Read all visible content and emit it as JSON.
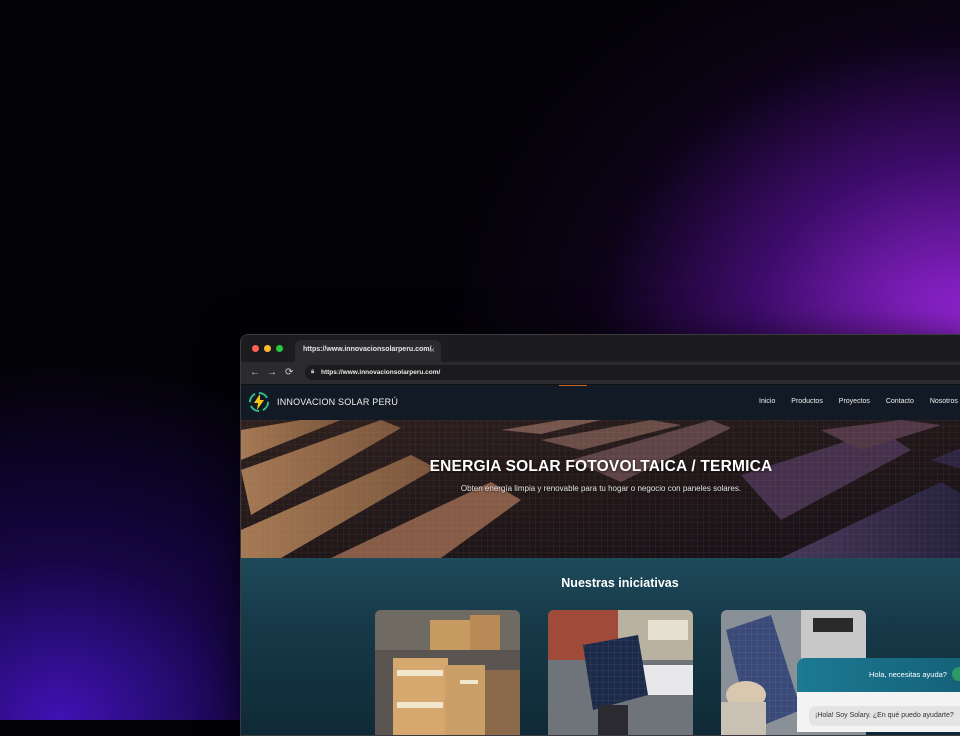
{
  "browser": {
    "tab_title": "https://www.innovacionsolarperu.com/",
    "tab_close": "×",
    "url": "https://www.innovacionsolarperu.com/",
    "back": "←",
    "forward": "→",
    "reload": "⟳"
  },
  "site": {
    "brand": "INNOVACION SOLAR PERÚ",
    "nav": [
      "Inicio",
      "Productos",
      "Proyectos",
      "Contacto",
      "Nosotros"
    ],
    "hero": {
      "title": "ENERGIA SOLAR FOTOVOLTAICA / TERMICA",
      "subtitle": "Obten energía limpia y renovable para tu hogar o negocio con paneles solares."
    },
    "section_title": "Nuestras iniciativas"
  },
  "chat": {
    "header": "Hola, necesitas ayuda?",
    "greeting": "¡Hola! Soy Solary. ¿En qué puedo ayudarte?"
  },
  "colors": {
    "accent_orange": "#c86a2a",
    "chat_teal": "#1c7a92",
    "background_purple": "#a028e6"
  }
}
